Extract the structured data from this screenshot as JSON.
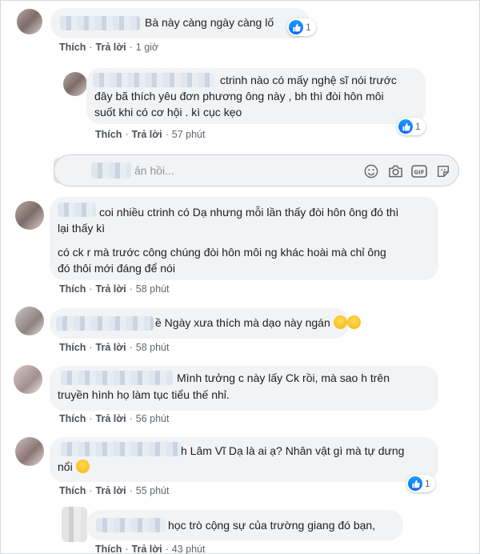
{
  "comments": [
    {
      "text_lines": [
        "Bà này càng ngày càng lố"
      ],
      "action_like": "Thích",
      "action_reply": "Trả lời",
      "time": "1 giờ",
      "reaction_count": "1"
    },
    {
      "text_lines": [
        "ctrinh nào có mấy nghệ sĩ nói trước",
        "đây bã thích yêu đơn phương ông này , bh thì đòi hôn môi",
        "suốt khi có cơ hội . kì cục kẹo"
      ],
      "action_like": "Thích",
      "action_reply": "Trả lời",
      "time": "57 phút",
      "reaction_count": "1"
    },
    {
      "text_lines": [
        "coi nhiều ctrinh có Dạ nhưng mỗi lần thấy đòi hôn ông đó thì",
        "lại thấy kì",
        "có ck r mà trước công chúng đòi hôn môi ng khác hoài mà chỉ ông",
        "đó thôi mới đáng để nói"
      ],
      "action_like": "Thích",
      "action_reply": "Trả lời",
      "time": "58 phút"
    },
    {
      "text_lines": [
        "ề Ngày xưa thích mà dạo này ngán"
      ],
      "action_like": "Thích",
      "action_reply": "Trả lời",
      "time": "58 phút"
    },
    {
      "text_lines": [
        "Mình tưởng c này lấy Ck rồi, mà sao h trên",
        "truyền hình họ làm tục tiểu thế nhỉ."
      ],
      "action_like": "Thích",
      "action_reply": "Trả lời",
      "time": "56 phút"
    },
    {
      "text_lines": [
        "h Lâm Vĩ Dạ là ai ạ? Nhân vật gì mà tự dưng",
        "nổi"
      ],
      "action_like": "Thích",
      "action_reply": "Trả lời",
      "time": "55 phút",
      "reaction_count": "1"
    },
    {
      "text_lines": [
        "học trò cộng sự của trường giang đó bạn,"
      ],
      "action_like": "Thích",
      "action_reply": "Trả lời",
      "time": "43 phút"
    }
  ],
  "composer": {
    "placeholder": "ản hồi..."
  },
  "colors": {
    "like_blue": "#0866ff",
    "link_gray": "#4b4f56",
    "bubble_bg": "#f2f3f5"
  },
  "icons": [
    "like-icon",
    "emoji-icon",
    "camera-icon",
    "gif-icon",
    "sticker-icon",
    "laughing-emoji-icon",
    "rolling-eyes-emoji-icon"
  ]
}
